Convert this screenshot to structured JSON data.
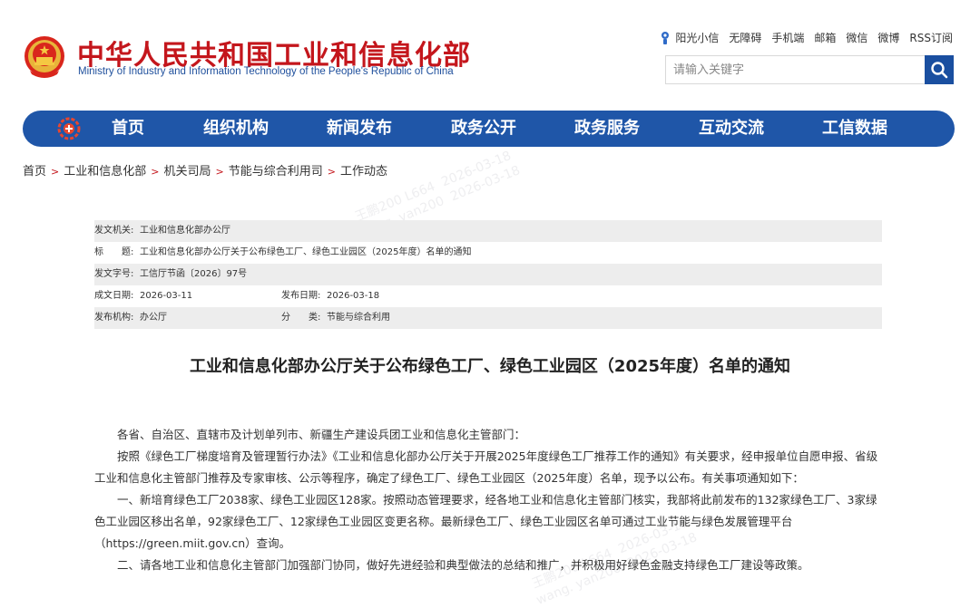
{
  "header": {
    "title": "中华人民共和国工业和信息化部",
    "subtitle": "Ministry of Industry and Information Technology of the People's Republic of China",
    "top_links": [
      "阳光小信",
      "无障碍",
      "手机端",
      "邮箱",
      "微信",
      "微博",
      "RSS订阅"
    ],
    "search_placeholder": "请输入关键字"
  },
  "nav": {
    "items": [
      "首页",
      "组织机构",
      "新闻发布",
      "政务公开",
      "政务服务",
      "互动交流",
      "工信数据"
    ]
  },
  "breadcrumb": [
    "首页",
    "工业和信息化部",
    "机关司局",
    "节能与综合利用司",
    "工作动态"
  ],
  "meta": {
    "issuer_label": "发文机关:",
    "issuer": "工业和信息化部办公厅",
    "title_label": "标　　题:",
    "title": "工业和信息化部办公厅关于公布绿色工厂、绿色工业园区（2025年度）名单的通知",
    "docno_label": "发文字号:",
    "docno": "工信厅节函〔2026〕97号",
    "date_label": "成文日期:",
    "date": "2026-03-11",
    "pubdate_label": "发布日期:",
    "pubdate": "2026-03-18",
    "org_label": "发布机构:",
    "org": "办公厅",
    "category_label": "分　　类:",
    "category": "节能与综合利用"
  },
  "doc": {
    "title": "工业和信息化部办公厅关于公布绿色工厂、绿色工业园区（2025年度）名单的通知",
    "salutation": "各省、自治区、直辖市及计划单列市、新疆生产建设兵团工业和信息化主管部门：",
    "paragraphs": [
      "按照《绿色工厂梯度培育及管理暂行办法》《工业和信息化部办公厅关于开展2025年度绿色工厂推荐工作的通知》有关要求，经申报单位自愿申报、省级工业和信息化主管部门推荐及专家审核、公示等程序，确定了绿色工厂、绿色工业园区（2025年度）名单，现予以公布。有关事项通知如下：",
      "一、新培育绿色工厂2038家、绿色工业园区128家。按照动态管理要求，经各地工业和信息化主管部门核实，我部将此前发布的132家绿色工厂、3家绿色工业园区移出名单，92家绿色工厂、12家绿色工业园区变更名称。最新绿色工厂、绿色工业园区名单可通过工业节能与绿色发展管理平台（https://green.miit.gov.cn）查询。",
      "二、请各地工业和信息化主管部门加强部门协同，做好先进经验和典型做法的总结和推广，并积极用好绿色金融支持绿色工厂建设等政策。"
    ]
  },
  "colors": {
    "brand_red": "#c4161c",
    "nav_blue": "#1f56a8",
    "search_blue": "#1a4fa0"
  },
  "icons": {
    "emblem": "national-emblem-icon",
    "search": "search-icon",
    "nav_logo": "miit-logo-icon",
    "sun": "sunshine-icon"
  }
}
